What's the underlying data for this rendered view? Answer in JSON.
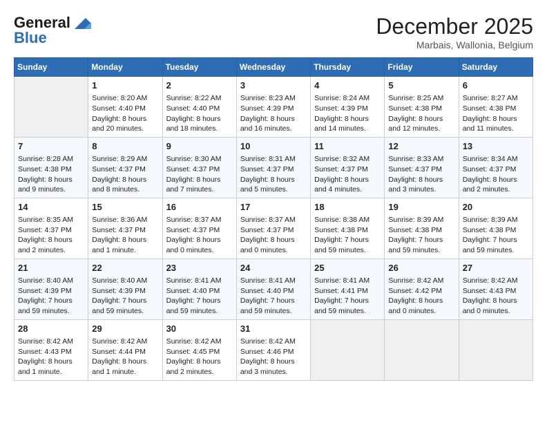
{
  "header": {
    "logo_line1": "General",
    "logo_line2": "Blue",
    "month_title": "December 2025",
    "location": "Marbais, Wallonia, Belgium"
  },
  "days_of_week": [
    "Sunday",
    "Monday",
    "Tuesday",
    "Wednesday",
    "Thursday",
    "Friday",
    "Saturday"
  ],
  "weeks": [
    [
      {
        "day": "",
        "sunrise": "",
        "sunset": "",
        "daylight": "",
        "empty": true
      },
      {
        "day": "1",
        "sunrise": "Sunrise: 8:20 AM",
        "sunset": "Sunset: 4:40 PM",
        "daylight": "Daylight: 8 hours and 20 minutes."
      },
      {
        "day": "2",
        "sunrise": "Sunrise: 8:22 AM",
        "sunset": "Sunset: 4:40 PM",
        "daylight": "Daylight: 8 hours and 18 minutes."
      },
      {
        "day": "3",
        "sunrise": "Sunrise: 8:23 AM",
        "sunset": "Sunset: 4:39 PM",
        "daylight": "Daylight: 8 hours and 16 minutes."
      },
      {
        "day": "4",
        "sunrise": "Sunrise: 8:24 AM",
        "sunset": "Sunset: 4:39 PM",
        "daylight": "Daylight: 8 hours and 14 minutes."
      },
      {
        "day": "5",
        "sunrise": "Sunrise: 8:25 AM",
        "sunset": "Sunset: 4:38 PM",
        "daylight": "Daylight: 8 hours and 12 minutes."
      },
      {
        "day": "6",
        "sunrise": "Sunrise: 8:27 AM",
        "sunset": "Sunset: 4:38 PM",
        "daylight": "Daylight: 8 hours and 11 minutes."
      }
    ],
    [
      {
        "day": "7",
        "sunrise": "Sunrise: 8:28 AM",
        "sunset": "Sunset: 4:38 PM",
        "daylight": "Daylight: 8 hours and 9 minutes."
      },
      {
        "day": "8",
        "sunrise": "Sunrise: 8:29 AM",
        "sunset": "Sunset: 4:37 PM",
        "daylight": "Daylight: 8 hours and 8 minutes."
      },
      {
        "day": "9",
        "sunrise": "Sunrise: 8:30 AM",
        "sunset": "Sunset: 4:37 PM",
        "daylight": "Daylight: 8 hours and 7 minutes."
      },
      {
        "day": "10",
        "sunrise": "Sunrise: 8:31 AM",
        "sunset": "Sunset: 4:37 PM",
        "daylight": "Daylight: 8 hours and 5 minutes."
      },
      {
        "day": "11",
        "sunrise": "Sunrise: 8:32 AM",
        "sunset": "Sunset: 4:37 PM",
        "daylight": "Daylight: 8 hours and 4 minutes."
      },
      {
        "day": "12",
        "sunrise": "Sunrise: 8:33 AM",
        "sunset": "Sunset: 4:37 PM",
        "daylight": "Daylight: 8 hours and 3 minutes."
      },
      {
        "day": "13",
        "sunrise": "Sunrise: 8:34 AM",
        "sunset": "Sunset: 4:37 PM",
        "daylight": "Daylight: 8 hours and 2 minutes."
      }
    ],
    [
      {
        "day": "14",
        "sunrise": "Sunrise: 8:35 AM",
        "sunset": "Sunset: 4:37 PM",
        "daylight": "Daylight: 8 hours and 2 minutes."
      },
      {
        "day": "15",
        "sunrise": "Sunrise: 8:36 AM",
        "sunset": "Sunset: 4:37 PM",
        "daylight": "Daylight: 8 hours and 1 minute."
      },
      {
        "day": "16",
        "sunrise": "Sunrise: 8:37 AM",
        "sunset": "Sunset: 4:37 PM",
        "daylight": "Daylight: 8 hours and 0 minutes."
      },
      {
        "day": "17",
        "sunrise": "Sunrise: 8:37 AM",
        "sunset": "Sunset: 4:37 PM",
        "daylight": "Daylight: 8 hours and 0 minutes."
      },
      {
        "day": "18",
        "sunrise": "Sunrise: 8:38 AM",
        "sunset": "Sunset: 4:38 PM",
        "daylight": "Daylight: 7 hours and 59 minutes."
      },
      {
        "day": "19",
        "sunrise": "Sunrise: 8:39 AM",
        "sunset": "Sunset: 4:38 PM",
        "daylight": "Daylight: 7 hours and 59 minutes."
      },
      {
        "day": "20",
        "sunrise": "Sunrise: 8:39 AM",
        "sunset": "Sunset: 4:38 PM",
        "daylight": "Daylight: 7 hours and 59 minutes."
      }
    ],
    [
      {
        "day": "21",
        "sunrise": "Sunrise: 8:40 AM",
        "sunset": "Sunset: 4:39 PM",
        "daylight": "Daylight: 7 hours and 59 minutes."
      },
      {
        "day": "22",
        "sunrise": "Sunrise: 8:40 AM",
        "sunset": "Sunset: 4:39 PM",
        "daylight": "Daylight: 7 hours and 59 minutes."
      },
      {
        "day": "23",
        "sunrise": "Sunrise: 8:41 AM",
        "sunset": "Sunset: 4:40 PM",
        "daylight": "Daylight: 7 hours and 59 minutes."
      },
      {
        "day": "24",
        "sunrise": "Sunrise: 8:41 AM",
        "sunset": "Sunset: 4:40 PM",
        "daylight": "Daylight: 7 hours and 59 minutes."
      },
      {
        "day": "25",
        "sunrise": "Sunrise: 8:41 AM",
        "sunset": "Sunset: 4:41 PM",
        "daylight": "Daylight: 7 hours and 59 minutes."
      },
      {
        "day": "26",
        "sunrise": "Sunrise: 8:42 AM",
        "sunset": "Sunset: 4:42 PM",
        "daylight": "Daylight: 8 hours and 0 minutes."
      },
      {
        "day": "27",
        "sunrise": "Sunrise: 8:42 AM",
        "sunset": "Sunset: 4:43 PM",
        "daylight": "Daylight: 8 hours and 0 minutes."
      }
    ],
    [
      {
        "day": "28",
        "sunrise": "Sunrise: 8:42 AM",
        "sunset": "Sunset: 4:43 PM",
        "daylight": "Daylight: 8 hours and 1 minute."
      },
      {
        "day": "29",
        "sunrise": "Sunrise: 8:42 AM",
        "sunset": "Sunset: 4:44 PM",
        "daylight": "Daylight: 8 hours and 1 minute."
      },
      {
        "day": "30",
        "sunrise": "Sunrise: 8:42 AM",
        "sunset": "Sunset: 4:45 PM",
        "daylight": "Daylight: 8 hours and 2 minutes."
      },
      {
        "day": "31",
        "sunrise": "Sunrise: 8:42 AM",
        "sunset": "Sunset: 4:46 PM",
        "daylight": "Daylight: 8 hours and 3 minutes."
      },
      {
        "day": "",
        "sunrise": "",
        "sunset": "",
        "daylight": "",
        "empty": true
      },
      {
        "day": "",
        "sunrise": "",
        "sunset": "",
        "daylight": "",
        "empty": true
      },
      {
        "day": "",
        "sunrise": "",
        "sunset": "",
        "daylight": "",
        "empty": true
      }
    ]
  ]
}
